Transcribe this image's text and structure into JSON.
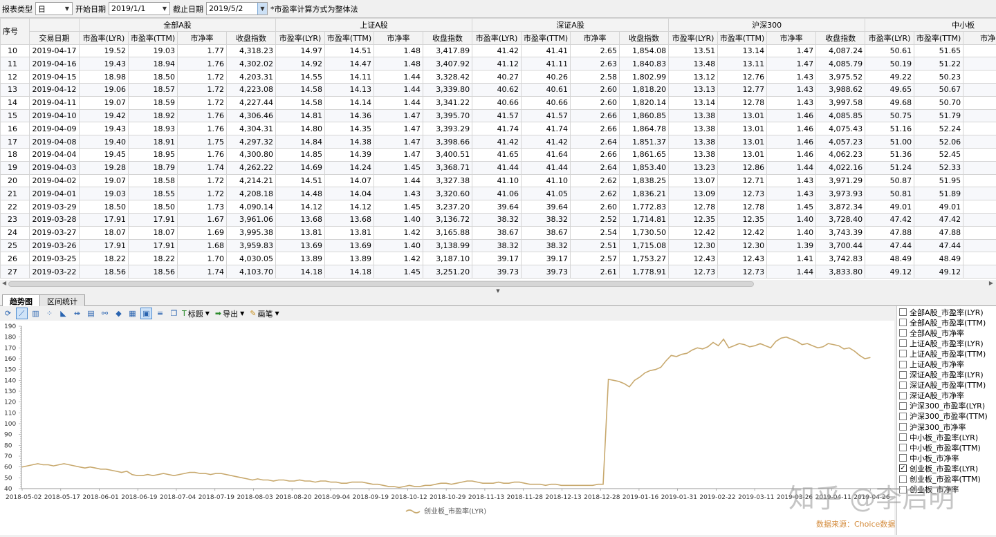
{
  "toolbar": {
    "report_type_label": "报表类型",
    "report_type_value": "日",
    "start_label": "开始日期",
    "start_value": "2019/1/1",
    "end_label": "截止日期",
    "end_value": "2019/5/2",
    "note": "*市盈率计算方式为整体法"
  },
  "table": {
    "idx_header": "序号",
    "date_header": "交易日期",
    "groups": [
      "全部A股",
      "上证A股",
      "深证A股",
      "沪深300",
      "中小板"
    ],
    "subcolumns": [
      "市盈率(LYR)",
      "市盈率(TTM)",
      "市净率",
      "收盘指数"
    ],
    "partial_col": "市净",
    "rows": [
      [
        "10",
        "2019-04-17",
        "19.52",
        "19.03",
        "1.77",
        "4,318.23",
        "14.97",
        "14.51",
        "1.48",
        "3,417.89",
        "41.42",
        "41.41",
        "2.65",
        "1,854.08",
        "13.51",
        "13.14",
        "1.47",
        "4,087.24",
        "50.61",
        "51.65"
      ],
      [
        "11",
        "2019-04-16",
        "19.43",
        "18.94",
        "1.76",
        "4,302.02",
        "14.92",
        "14.47",
        "1.48",
        "3,407.92",
        "41.12",
        "41.11",
        "2.63",
        "1,840.83",
        "13.48",
        "13.11",
        "1.47",
        "4,085.79",
        "50.19",
        "51.22"
      ],
      [
        "12",
        "2019-04-15",
        "18.98",
        "18.50",
        "1.72",
        "4,203.31",
        "14.55",
        "14.11",
        "1.44",
        "3,328.42",
        "40.27",
        "40.26",
        "2.58",
        "1,802.99",
        "13.12",
        "12.76",
        "1.43",
        "3,975.52",
        "49.22",
        "50.23"
      ],
      [
        "13",
        "2019-04-12",
        "19.06",
        "18.57",
        "1.72",
        "4,223.08",
        "14.58",
        "14.13",
        "1.44",
        "3,339.80",
        "40.62",
        "40.61",
        "2.60",
        "1,818.20",
        "13.13",
        "12.77",
        "1.43",
        "3,988.62",
        "49.65",
        "50.67"
      ],
      [
        "14",
        "2019-04-11",
        "19.07",
        "18.59",
        "1.72",
        "4,227.44",
        "14.58",
        "14.14",
        "1.44",
        "3,341.22",
        "40.66",
        "40.66",
        "2.60",
        "1,820.14",
        "13.14",
        "12.78",
        "1.43",
        "3,997.58",
        "49.68",
        "50.70"
      ],
      [
        "15",
        "2019-04-10",
        "19.42",
        "18.92",
        "1.76",
        "4,306.46",
        "14.81",
        "14.36",
        "1.47",
        "3,395.70",
        "41.57",
        "41.57",
        "2.66",
        "1,860.85",
        "13.38",
        "13.01",
        "1.46",
        "4,085.85",
        "50.75",
        "51.79"
      ],
      [
        "16",
        "2019-04-09",
        "19.43",
        "18.93",
        "1.76",
        "4,304.31",
        "14.80",
        "14.35",
        "1.47",
        "3,393.29",
        "41.74",
        "41.74",
        "2.66",
        "1,864.78",
        "13.38",
        "13.01",
        "1.46",
        "4,075.43",
        "51.16",
        "52.24"
      ],
      [
        "17",
        "2019-04-08",
        "19.40",
        "18.91",
        "1.75",
        "4,297.32",
        "14.84",
        "14.38",
        "1.47",
        "3,398.66",
        "41.42",
        "41.42",
        "2.64",
        "1,851.37",
        "13.38",
        "13.01",
        "1.46",
        "4,057.23",
        "51.00",
        "52.06"
      ],
      [
        "18",
        "2019-04-04",
        "19.45",
        "18.95",
        "1.76",
        "4,300.80",
        "14.85",
        "14.39",
        "1.47",
        "3,400.51",
        "41.65",
        "41.64",
        "2.66",
        "1,861.65",
        "13.38",
        "13.01",
        "1.46",
        "4,062.23",
        "51.36",
        "52.45"
      ],
      [
        "19",
        "2019-04-03",
        "19.28",
        "18.79",
        "1.74",
        "4,262.22",
        "14.69",
        "14.24",
        "1.45",
        "3,368.71",
        "41.44",
        "41.44",
        "2.64",
        "1,853.40",
        "13.23",
        "12.86",
        "1.44",
        "4,022.16",
        "51.24",
        "52.33"
      ],
      [
        "20",
        "2019-04-02",
        "19.07",
        "18.58",
        "1.72",
        "4,214.21",
        "14.51",
        "14.07",
        "1.44",
        "3,327.38",
        "41.10",
        "41.10",
        "2.62",
        "1,838.25",
        "13.07",
        "12.71",
        "1.43",
        "3,971.29",
        "50.87",
        "51.95"
      ],
      [
        "21",
        "2019-04-01",
        "19.03",
        "18.55",
        "1.72",
        "4,208.18",
        "14.48",
        "14.04",
        "1.43",
        "3,320.60",
        "41.06",
        "41.05",
        "2.62",
        "1,836.21",
        "13.09",
        "12.73",
        "1.43",
        "3,973.93",
        "50.81",
        "51.89"
      ],
      [
        "22",
        "2019-03-29",
        "18.50",
        "18.50",
        "1.73",
        "4,090.14",
        "14.12",
        "14.12",
        "1.45",
        "3,237.20",
        "39.64",
        "39.64",
        "2.60",
        "1,772.83",
        "12.78",
        "12.78",
        "1.45",
        "3,872.34",
        "49.01",
        "49.01"
      ],
      [
        "23",
        "2019-03-28",
        "17.91",
        "17.91",
        "1.67",
        "3,961.06",
        "13.68",
        "13.68",
        "1.40",
        "3,136.72",
        "38.32",
        "38.32",
        "2.52",
        "1,714.81",
        "12.35",
        "12.35",
        "1.40",
        "3,728.40",
        "47.42",
        "47.42"
      ],
      [
        "24",
        "2019-03-27",
        "18.07",
        "18.07",
        "1.69",
        "3,995.38",
        "13.81",
        "13.81",
        "1.42",
        "3,165.88",
        "38.67",
        "38.67",
        "2.54",
        "1,730.50",
        "12.42",
        "12.42",
        "1.40",
        "3,743.39",
        "47.88",
        "47.88"
      ],
      [
        "25",
        "2019-03-26",
        "17.91",
        "17.91",
        "1.68",
        "3,959.83",
        "13.69",
        "13.69",
        "1.40",
        "3,138.99",
        "38.32",
        "38.32",
        "2.51",
        "1,715.08",
        "12.30",
        "12.30",
        "1.39",
        "3,700.44",
        "47.44",
        "47.44"
      ],
      [
        "26",
        "2019-03-25",
        "18.22",
        "18.22",
        "1.70",
        "4,030.05",
        "13.89",
        "13.89",
        "1.42",
        "3,187.10",
        "39.17",
        "39.17",
        "2.57",
        "1,753.27",
        "12.43",
        "12.43",
        "1.41",
        "3,742.83",
        "48.49",
        "48.49"
      ],
      [
        "27",
        "2019-03-22",
        "18.56",
        "18.56",
        "1.74",
        "4,103.70",
        "14.18",
        "14.18",
        "1.45",
        "3,251.20",
        "39.73",
        "39.73",
        "2.61",
        "1,778.91",
        "12.73",
        "12.73",
        "1.44",
        "3,833.80",
        "49.12",
        "49.12"
      ]
    ]
  },
  "tabs": [
    "趋势图",
    "区间统计"
  ],
  "chart_toolbar": {
    "title_btn": "标题",
    "export_btn": "导出",
    "pen_btn": "画笔"
  },
  "legend_items": [
    {
      "label": "全部A股_市盈率(LYR)",
      "checked": false
    },
    {
      "label": "全部A股_市盈率(TTM)",
      "checked": false
    },
    {
      "label": "全部A股_市净率",
      "checked": false
    },
    {
      "label": "上证A股_市盈率(LYR)",
      "checked": false
    },
    {
      "label": "上证A股_市盈率(TTM)",
      "checked": false
    },
    {
      "label": "上证A股_市净率",
      "checked": false
    },
    {
      "label": "深证A股_市盈率(LYR)",
      "checked": false
    },
    {
      "label": "深证A股_市盈率(TTM)",
      "checked": false
    },
    {
      "label": "深证A股_市净率",
      "checked": false
    },
    {
      "label": "沪深300_市盈率(LYR)",
      "checked": false
    },
    {
      "label": "沪深300_市盈率(TTM)",
      "checked": false
    },
    {
      "label": "沪深300_市净率",
      "checked": false
    },
    {
      "label": "中小板_市盈率(LYR)",
      "checked": false
    },
    {
      "label": "中小板_市盈率(TTM)",
      "checked": false
    },
    {
      "label": "中小板_市净率",
      "checked": false
    },
    {
      "label": "创业板_市盈率(LYR)",
      "checked": true
    },
    {
      "label": "创业板_市盈率(TTM)",
      "checked": false
    },
    {
      "label": "创业板_市净率",
      "checked": false
    }
  ],
  "chart_data": {
    "type": "line",
    "series_name": "创业板_市盈率(LYR)",
    "color": "#c8a96e",
    "ylim": [
      40,
      190
    ],
    "yticks": [
      40,
      50,
      60,
      70,
      80,
      90,
      100,
      110,
      120,
      130,
      140,
      150,
      160,
      170,
      180,
      190
    ],
    "xticks": [
      "2018-05-02",
      "2018-05-17",
      "2018-06-01",
      "2018-06-19",
      "2018-07-04",
      "2018-07-19",
      "2018-08-03",
      "2018-08-20",
      "2018-09-04",
      "2018-09-19",
      "2018-10-12",
      "2018-10-29",
      "2018-11-13",
      "2018-11-28",
      "2018-12-13",
      "2018-12-28",
      "2019-01-16",
      "2019-01-31",
      "2019-02-22",
      "2019-03-11",
      "2019-03-26",
      "2019-04-11",
      "2019-04-26"
    ],
    "values": [
      60,
      61,
      62,
      63,
      62,
      62,
      61,
      62,
      63,
      62,
      61,
      60,
      59,
      60,
      59,
      58,
      58,
      57,
      56,
      55,
      56,
      53,
      52,
      52,
      53,
      52,
      53,
      54,
      53,
      52,
      53,
      54,
      55,
      55,
      54,
      54,
      53,
      54,
      54,
      53,
      52,
      51,
      50,
      49,
      48,
      49,
      48,
      48,
      47,
      48,
      48,
      47,
      47,
      48,
      47,
      47,
      46,
      47,
      47,
      46,
      46,
      45,
      45,
      46,
      46,
      46,
      45,
      44,
      44,
      43,
      42,
      42,
      41,
      42,
      43,
      42,
      42,
      43,
      43,
      44,
      45,
      45,
      44,
      45,
      46,
      47,
      47,
      46,
      45,
      45,
      45,
      46,
      45,
      45,
      46,
      46,
      45,
      44,
      44,
      44,
      43,
      44,
      44,
      43,
      43,
      43,
      43,
      43,
      43,
      43,
      44,
      44,
      141,
      140,
      139,
      137,
      134,
      140,
      143,
      147,
      149,
      150,
      152,
      158,
      163,
      162,
      164,
      165,
      168,
      170,
      169,
      171,
      175,
      172,
      178,
      170,
      172,
      174,
      173,
      171,
      172,
      174,
      172,
      170,
      176,
      179,
      180,
      178,
      176,
      173,
      174,
      172,
      170,
      171,
      174,
      173,
      172,
      169,
      170,
      167,
      163,
      160,
      161
    ]
  },
  "source_note": "数据来源：Choice数据",
  "watermark": "知乎 @李启明"
}
